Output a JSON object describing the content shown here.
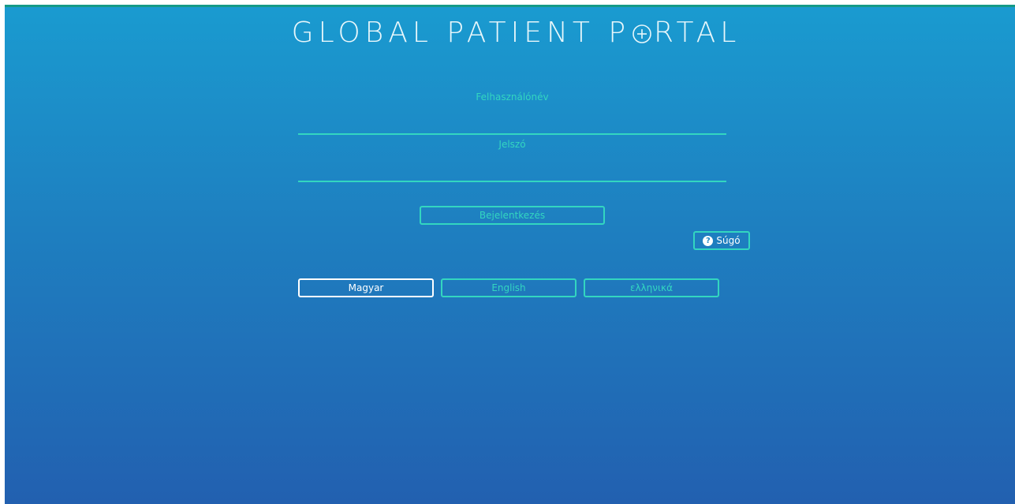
{
  "app": {
    "title_left": "GLOBAL PATIENT P",
    "title_right": "RTAL"
  },
  "login": {
    "username_label": "Felhasználónév",
    "username_value": "",
    "password_label": "Jelszó",
    "password_value": "",
    "submit_label": "Bejelentkezés"
  },
  "help": {
    "icon": "question-circle-icon",
    "label": "Súgó"
  },
  "languages": [
    {
      "label": "Magyar",
      "active": true
    },
    {
      "label": "English",
      "active": false
    },
    {
      "label": "ελληνικά",
      "active": false
    }
  ],
  "colors": {
    "accent": "#33d6c0",
    "background_top": "#1a9bd0",
    "background_bottom": "#2260b0",
    "top_bar": "#159a86"
  }
}
